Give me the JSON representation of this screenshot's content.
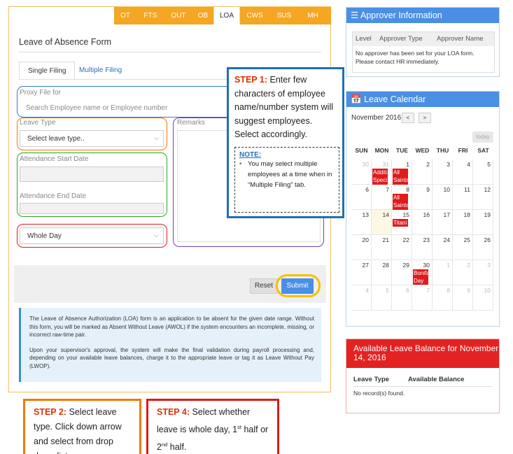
{
  "tabs": [
    {
      "label": "OT",
      "active": false
    },
    {
      "label": "FTS",
      "active": false
    },
    {
      "label": "OUT",
      "active": false
    },
    {
      "label": "OB",
      "active": false
    },
    {
      "label": "LOA",
      "active": true
    },
    {
      "label": "CWS",
      "active": false
    },
    {
      "label": "SUS",
      "active": false
    },
    {
      "label": "MH",
      "active": false
    }
  ],
  "form": {
    "title": "Leave of Absence Form",
    "filing_tabs": [
      "Single Filing",
      "Multiple Filing"
    ],
    "proxy_label": "Proxy File for",
    "proxy_placeholder": "Search Employee name or Employee number",
    "leave_type_label": "Leave Type",
    "leave_type_value": "Select leave type..",
    "remarks_label": "Remarks",
    "start_label": "Attendance Start Date",
    "end_label": "Attendance End Date",
    "day_part_value": "Whole Day",
    "reset_label": "Reset",
    "submit_label": "Submit",
    "info_p1": "The Leave of Absence Authorization (LOA) form is an application to be absent for the given date range. Without this form, you will be marked as Absent Without Leave (AWOL) if the system encounters an incomplete, missing, or incorrect raw-time pair.",
    "info_p2": "Upon your supervisor's approval, the system will make the final validation during payroll processing and, depending on your available leave balances, charge it to the appropriate leave or tag it as Leave Without Pay (LWOP)."
  },
  "step1": {
    "lead": "STEP 1:",
    "text": "Enter few characters of employee name/number system will suggest employees. Select accordingly.",
    "note_title": "NOTE:",
    "note_item": "You may select multiple employees at a time when in “Multiple Filing” tab."
  },
  "approver": {
    "title": "Approver Information",
    "columns": [
      "Level",
      "Approver Type",
      "Approver Name"
    ],
    "message": "No approver has been set for your LOA form. Please contact HR immediately."
  },
  "calendar": {
    "title": "Leave Calendar",
    "month": "November 2016",
    "prev": "<",
    "next": ">",
    "today_label": "today",
    "dow": [
      "SUN",
      "MON",
      "TUE",
      "WED",
      "THU",
      "FRI",
      "SAT"
    ],
    "weeks": [
      [
        {
          "d": "30",
          "m": true
        },
        {
          "d": "31",
          "m": true
        },
        {
          "d": "1"
        },
        {
          "d": "2"
        },
        {
          "d": "3"
        },
        {
          "d": "4"
        },
        {
          "d": "5"
        }
      ],
      [
        {
          "d": "6"
        },
        {
          "d": "7"
        },
        {
          "d": "8"
        },
        {
          "d": "9"
        },
        {
          "d": "10"
        },
        {
          "d": "11"
        },
        {
          "d": "12"
        }
      ],
      [
        {
          "d": "13"
        },
        {
          "d": "14",
          "today": true
        },
        {
          "d": "15"
        },
        {
          "d": "16"
        },
        {
          "d": "17"
        },
        {
          "d": "18"
        },
        {
          "d": "19"
        }
      ],
      [
        {
          "d": "20"
        },
        {
          "d": "21"
        },
        {
          "d": "22"
        },
        {
          "d": "23"
        },
        {
          "d": "24"
        },
        {
          "d": "25"
        },
        {
          "d": "26"
        }
      ],
      [
        {
          "d": "27"
        },
        {
          "d": "28"
        },
        {
          "d": "29"
        },
        {
          "d": "30"
        },
        {
          "d": "1",
          "m": true
        },
        {
          "d": "2",
          "m": true
        },
        {
          "d": "3",
          "m": true
        }
      ],
      [
        {
          "d": "4",
          "m": true
        },
        {
          "d": "5",
          "m": true
        },
        {
          "d": "6",
          "m": true
        },
        {
          "d": "7",
          "m": true
        },
        {
          "d": "8",
          "m": true
        },
        {
          "d": "9",
          "m": true
        },
        {
          "d": "10",
          "m": true
        }
      ]
    ],
    "events": [
      {
        "week": 0,
        "dow": 1,
        "lines": [
          "Additi",
          "Speci",
          "non-",
          "workin"
        ]
      },
      {
        "week": 0,
        "dow": 2,
        "lines": [
          "All",
          "Saints",
          "Day"
        ]
      },
      {
        "week": 1,
        "dow": 2,
        "lines": [
          "All",
          "Saints",
          "Day"
        ]
      },
      {
        "week": 2,
        "dow": 2,
        "lines": [
          "Titani"
        ]
      },
      {
        "week": 4,
        "dow": 3,
        "lines": [
          "Bonifa",
          "Day"
        ]
      }
    ]
  },
  "balance": {
    "title": "Available Leave Balance for November 14, 2016",
    "columns": [
      "Leave Type",
      "Available Balance"
    ],
    "message": "No record(s) found."
  },
  "step2": {
    "lead": "STEP 2:",
    "text": "Select leave type. Click down arrow and select from drop down list."
  },
  "step4": {
    "lead": "STEP 4:",
    "text_a": "Select whether leave is whole day, 1",
    "sup_1": "st",
    "text_b": " half or 2",
    "sup_2": "nd",
    "text_c": " half."
  },
  "colors": {
    "tab_orange": "#f5a623",
    "panel_blue": "#4a8fe4",
    "balance_red": "#e32222",
    "event_red": "#e01b1b",
    "step1_border": "#1f6fb5",
    "step2_border": "#f07a00",
    "step4_border": "#e01b1b",
    "submit_ring": "#f5c000"
  },
  "icons": {
    "approver": "list-icon",
    "calendar": "calendar-icon",
    "select_arrow": "chevron-down-icon"
  }
}
